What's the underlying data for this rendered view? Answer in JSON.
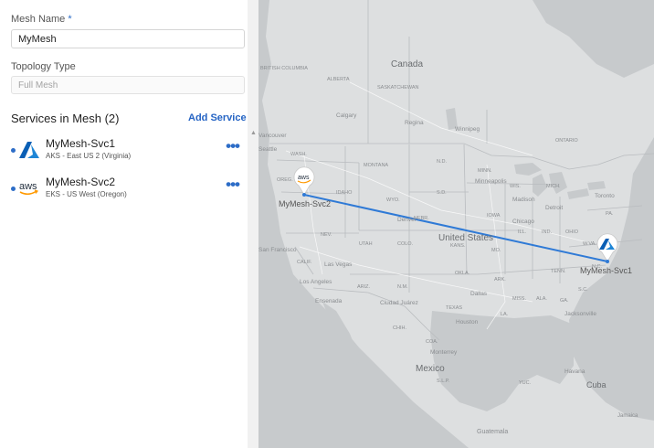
{
  "form": {
    "mesh_name_label": "Mesh Name",
    "required_marker": "*",
    "mesh_name_value": "MyMesh",
    "topology_label": "Topology Type",
    "topology_value": "Full Mesh"
  },
  "services": {
    "title": "Services in Mesh (2)",
    "add_label": "Add Service",
    "items": [
      {
        "name": "MyMesh-Svc1",
        "detail": "AKS - East US 2 (Virginia)",
        "logo": "azure-logo",
        "menu": "•••"
      },
      {
        "name": "MyMesh-Svc2",
        "detail": "EKS - US West (Oregon)",
        "logo": "aws-logo",
        "menu": "•••"
      }
    ]
  },
  "map": {
    "countries": {
      "canada": "Canada",
      "united_states": "United States",
      "mexico": "Mexico",
      "cuba": "Cuba",
      "guatemala": "Guatemala",
      "jamaica": "Jamaica"
    },
    "regions": {
      "british_columbia": "BRITISH COLUMBIA",
      "alberta": "ALBERTA",
      "saskatchewan": "SASKATCHEWAN",
      "ontario": "ONTARIO",
      "washington": "WASH.",
      "montana": "MONTANA",
      "nd": "N.D.",
      "minn": "MINN.",
      "oregon": "OREG.",
      "idaho": "IDAHO",
      "wyo": "WYO.",
      "sd": "S.D.",
      "wis": "WIS.",
      "mich": "MICH.",
      "nebr": "NEBR.",
      "iowa": "IOWA",
      "nev": "NEV.",
      "utah": "UTAH",
      "colo": "COLO.",
      "kans": "KANS.",
      "mo": "MO.",
      "ill": "ILL.",
      "ind": "IND.",
      "ohio": "OHIO",
      "pa": "PA.",
      "wva": "W.VA.",
      "calif": "CALIF.",
      "ariz": "ARIZ.",
      "nm": "N.M.",
      "okla": "OKLA.",
      "ark": "ARK.",
      "tenn": "TENN.",
      "nc": "N.C.",
      "sc": "S.C.",
      "texas": "TEXAS",
      "la": "LA.",
      "miss": "MISS.",
      "ala": "ALA.",
      "ga": "GA.",
      "chih": "CHIH.",
      "coa": "COA.",
      "slp": "S.L.P.",
      "yuc": "YUC."
    },
    "cities": {
      "calgary": "Calgary",
      "regina": "Regina",
      "winnipeg": "Winnipeg",
      "vancouver": "Vancouver",
      "seattle": "Seattle",
      "minneapolis": "Minneapolis",
      "toronto": "Toronto",
      "madison": "Madison",
      "detroit": "Detroit",
      "chicago": "Chicago",
      "denver": "Denver",
      "san_francisco": "San Francisco",
      "las_vegas": "Las Vegas",
      "los_angeles": "Los Angeles",
      "ensenada": "Ensenada",
      "ciudad_juarez": "Ciudad Juárez",
      "dallas": "Dallas",
      "houston": "Houston",
      "monterrey": "Monterrey",
      "jacksonville": "Jacksonville",
      "havana": "Havana"
    },
    "markers": [
      {
        "label": "MyMesh-Svc2",
        "logo": "aws-logo"
      },
      {
        "label": "MyMesh-Svc1",
        "logo": "azure-logo"
      }
    ],
    "connection_color": "#2f7ad6"
  },
  "colors": {
    "accent": "#2d6dc7",
    "link": "#2564c4",
    "map_land": "#dddfe0",
    "map_water": "#c7cacc",
    "connection": "#2f7ad6"
  }
}
